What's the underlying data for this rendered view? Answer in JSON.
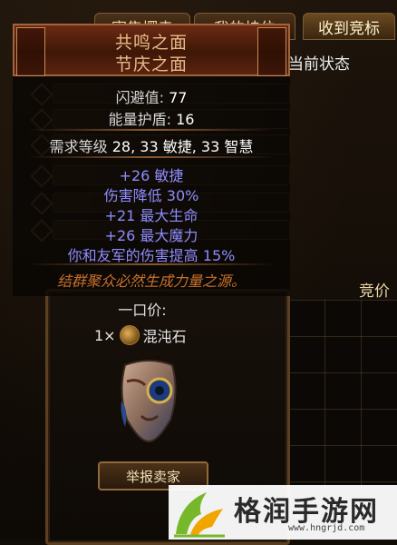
{
  "tabs": {
    "sell_order": "寄售摆卖",
    "my_listing": "我的挂位",
    "received_bids": "收到竞标"
  },
  "status_column_label": "当前状态",
  "price_column_label": "竞价",
  "tooltip": {
    "name_line1": "共鸣之面",
    "name_line2": "节庆之面",
    "properties": [
      {
        "label": "闪避值: ",
        "value": "77"
      },
      {
        "label": "能量护盾: ",
        "value": "16"
      }
    ],
    "requirements": {
      "label": "需求等级 ",
      "value": "28, 33 敏捷, 33 智慧"
    },
    "mods": [
      "+26 敏捷",
      "伤害降低 30%",
      "+21 最大生命",
      "+26 最大魔力",
      "你和友军的伤害提高 15%"
    ],
    "flavor": "结群聚众必然生成力量之源。"
  },
  "buyout": {
    "title": "一口价:",
    "quantity": "1×",
    "currency_name": "混沌石"
  },
  "report_button": "举报卖家",
  "watermark": {
    "title": "格润手游网",
    "url": "www.hngrjd.com"
  }
}
